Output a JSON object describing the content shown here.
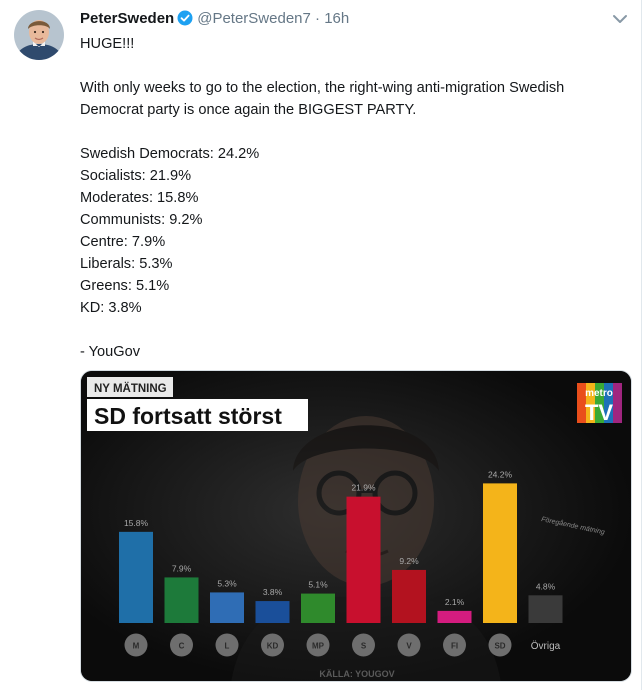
{
  "tweet": {
    "author_name": "PeterSweden",
    "handle": "@PeterSweden7",
    "separator": "·",
    "time": "16h",
    "lines": [
      "HUGE!!!",
      "",
      "With only weeks to go to the election, the right-wing anti-migration Swedish",
      "Democrat party is once again the BIGGEST PARTY.",
      "",
      "Swedish Democrats: 24.2%",
      "Socialists: 21.9%",
      "Moderates: 15.8%",
      "Communists: 9.2%",
      "Centre: 7.9%",
      "Liberals: 5.3%",
      "Greens: 5.1%",
      "KD: 3.8%",
      "",
      "- YouGov"
    ]
  },
  "media": {
    "tag": "NY MÄTNING",
    "headline": "SD fortsatt störst",
    "logo_top": "metro",
    "logo_bottom": "TV",
    "side_note": "Föregående mätning",
    "source": "KÄLLA: YOUGOV",
    "other_label": "Övriga"
  },
  "chart_data": {
    "type": "bar",
    "categories": [
      "M",
      "C",
      "L",
      "KD",
      "MP",
      "S",
      "V",
      "FI",
      "SD",
      "Övriga"
    ],
    "values": [
      15.8,
      7.9,
      5.3,
      3.8,
      5.1,
      21.9,
      9.2,
      2.1,
      24.2,
      4.8
    ],
    "labels": [
      "15.8%",
      "7.9%",
      "5.3%",
      "3.8%",
      "5.1%",
      "21.9%",
      "9.2%",
      "2.1%",
      "24.2%",
      "4.8%"
    ],
    "colors": [
      "#1f6fa8",
      "#1d7a3a",
      "#2f6db5",
      "#1a4f9a",
      "#2f8a2c",
      "#c8102e",
      "#b3121f",
      "#d41c7f",
      "#f4b41a",
      "#3a3a3a"
    ],
    "title": "SD fortsatt störst",
    "ylim": [
      0,
      26
    ]
  }
}
